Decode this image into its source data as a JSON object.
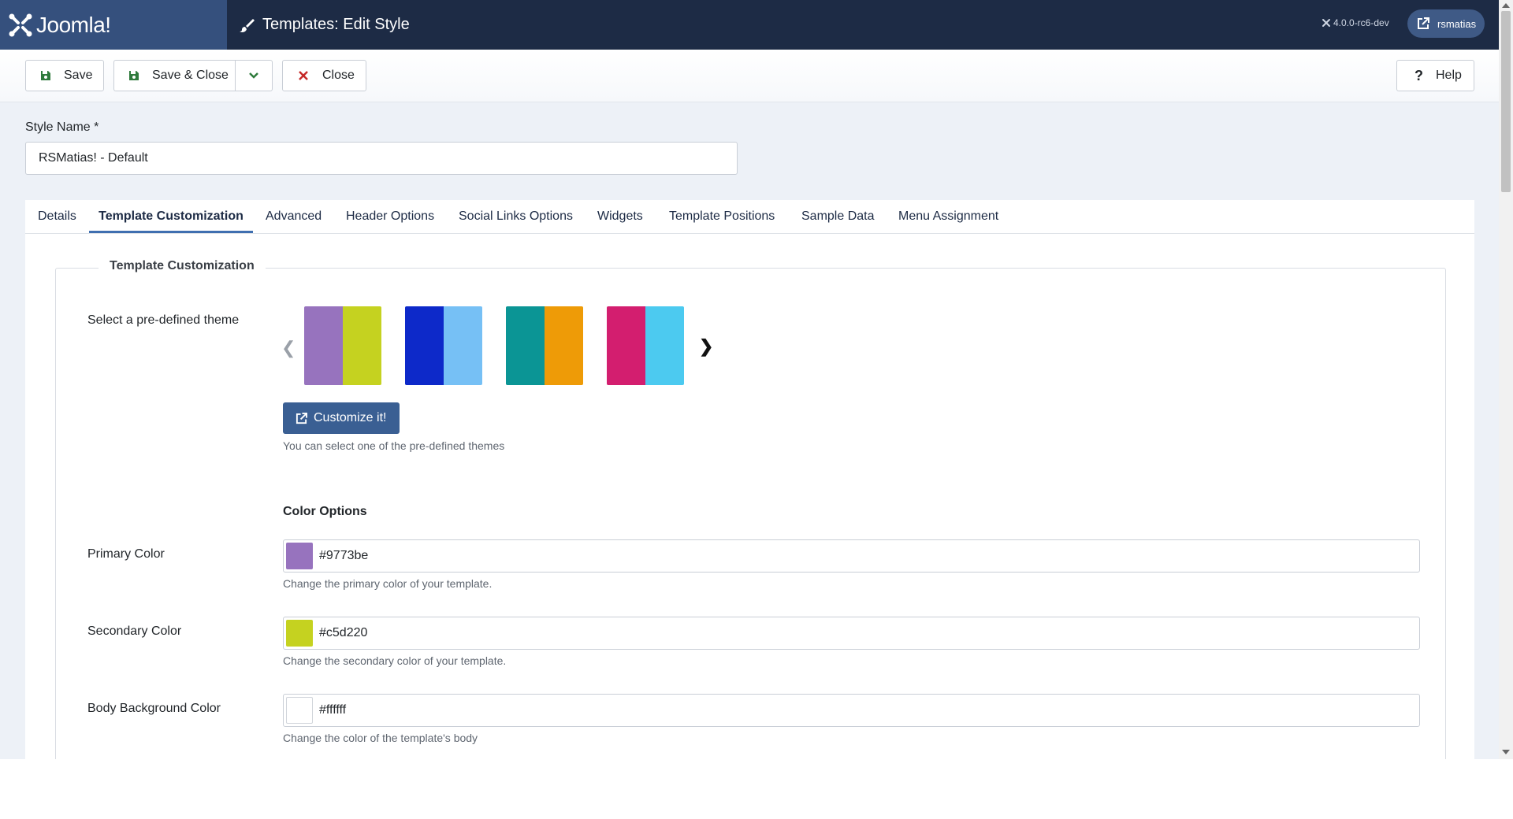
{
  "header": {
    "logo_text": "Joomla!",
    "title": "Templates: Edit Style",
    "version": "4.0.0-rc6-dev",
    "user": "rsmatias"
  },
  "toolbar": {
    "save_label": "Save",
    "save_close_label": "Save & Close",
    "close_label": "Close",
    "help_label": "Help"
  },
  "form": {
    "style_name_label": "Style Name *",
    "style_name_value": "RSMatias! - Default"
  },
  "tabs": [
    {
      "label": "Details"
    },
    {
      "label": "Template Customization",
      "active": true
    },
    {
      "label": "Advanced"
    },
    {
      "label": "Header Options"
    },
    {
      "label": "Social Links Options"
    },
    {
      "label": "Widgets"
    },
    {
      "label": "Template Positions"
    },
    {
      "label": "Sample Data"
    },
    {
      "label": "Menu Assignment"
    }
  ],
  "customization": {
    "legend": "Template Customization",
    "theme_label": "Select a pre-defined theme",
    "themes": [
      {
        "left": "#9773be",
        "right": "#c5d220"
      },
      {
        "left": "#0d29c9",
        "right": "#76c0f5"
      },
      {
        "left": "#0b9595",
        "right": "#ee9b07"
      },
      {
        "left": "#d31e6f",
        "right": "#4ccaf0"
      }
    ],
    "customize_label": "Customize it!",
    "theme_hint": "You can select one of the pre-defined themes",
    "color_options_title": "Color Options",
    "colors": [
      {
        "label": "Primary Color",
        "value": "#9773be",
        "hint": "Change the primary color of your template."
      },
      {
        "label": "Secondary Color",
        "value": "#c5d220",
        "hint": "Change the secondary color of your template."
      },
      {
        "label": "Body Background Color",
        "value": "#ffffff",
        "hint": "Change the color of the template's body"
      }
    ]
  }
}
